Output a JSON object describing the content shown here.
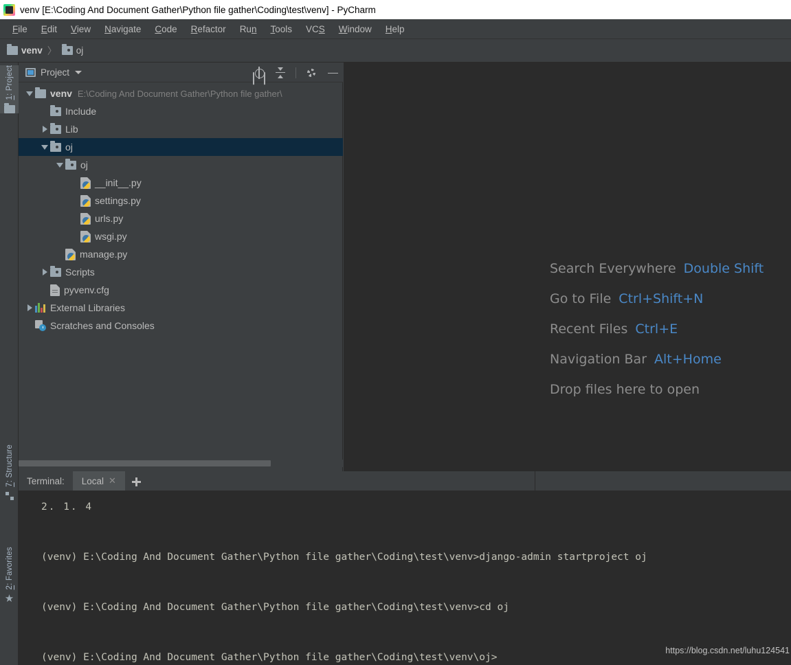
{
  "window": {
    "title": "venv [E:\\Coding And Document Gather\\Python file gather\\Coding\\test\\venv] - PyCharm",
    "logo_icon": "pycharm-logo-icon",
    "logo_text": "PC"
  },
  "menubar": {
    "items": [
      {
        "label": "File",
        "mnemonic": "F"
      },
      {
        "label": "Edit",
        "mnemonic": "E"
      },
      {
        "label": "View",
        "mnemonic": "V"
      },
      {
        "label": "Navigate",
        "mnemonic": "N"
      },
      {
        "label": "Code",
        "mnemonic": "C"
      },
      {
        "label": "Refactor",
        "mnemonic": "R"
      },
      {
        "label": "Run",
        "mnemonic": "n"
      },
      {
        "label": "Tools",
        "mnemonic": "T"
      },
      {
        "label": "VCS",
        "mnemonic": "S"
      },
      {
        "label": "Window",
        "mnemonic": "W"
      },
      {
        "label": "Help",
        "mnemonic": "H"
      }
    ]
  },
  "breadcrumb": {
    "separator": "〉",
    "items": [
      {
        "label": "venv",
        "icon": "folder-icon"
      },
      {
        "label": "oj",
        "icon": "folder-open-icon"
      }
    ]
  },
  "left_strip": {
    "top_tabs": [
      {
        "label": "1: Project",
        "icon": "project-folder-icon",
        "active": true
      }
    ],
    "bottom_tabs": [
      {
        "label": "7: Structure",
        "icon": "structure-icon",
        "active": false
      },
      {
        "label": "2: Favorites",
        "icon": "star-icon",
        "active": false
      }
    ]
  },
  "project_panel": {
    "title": "Project",
    "window_icon": "project-window-icon",
    "dropdown_icon": "chevron-down-icon",
    "toolbar": [
      {
        "name": "locate-icon",
        "tooltip": "Select Opened File"
      },
      {
        "name": "collapse-all-icon",
        "tooltip": "Collapse All"
      },
      {
        "name": "gear-icon",
        "tooltip": "Settings"
      },
      {
        "name": "hide-icon",
        "tooltip": "Hide"
      }
    ],
    "tree": [
      {
        "label": "venv",
        "path": "E:\\Coding And Document Gather\\Python file gather\\",
        "icon": "folder-icon",
        "arrow": "down",
        "indent": 0,
        "bold": true,
        "selected": false
      },
      {
        "label": "Include",
        "path": "",
        "icon": "folder-open-icon",
        "arrow": "none",
        "indent": 1,
        "bold": false,
        "selected": false
      },
      {
        "label": "Lib",
        "path": "",
        "icon": "folder-open-icon",
        "arrow": "right",
        "indent": 1,
        "bold": false,
        "selected": false
      },
      {
        "label": "oj",
        "path": "",
        "icon": "folder-open-icon",
        "arrow": "down",
        "indent": 1,
        "bold": false,
        "selected": true
      },
      {
        "label": "oj",
        "path": "",
        "icon": "folder-open-icon",
        "arrow": "down",
        "indent": 2,
        "bold": false,
        "selected": false
      },
      {
        "label": "__init__.py",
        "path": "",
        "icon": "python-file-icon",
        "arrow": "none",
        "indent": 3,
        "bold": false,
        "selected": false
      },
      {
        "label": "settings.py",
        "path": "",
        "icon": "python-file-icon",
        "arrow": "none",
        "indent": 3,
        "bold": false,
        "selected": false
      },
      {
        "label": "urls.py",
        "path": "",
        "icon": "python-file-icon",
        "arrow": "none",
        "indent": 3,
        "bold": false,
        "selected": false
      },
      {
        "label": "wsgi.py",
        "path": "",
        "icon": "python-file-icon",
        "arrow": "none",
        "indent": 3,
        "bold": false,
        "selected": false
      },
      {
        "label": "manage.py",
        "path": "",
        "icon": "python-file-icon",
        "arrow": "none",
        "indent": 2,
        "bold": false,
        "selected": false
      },
      {
        "label": "Scripts",
        "path": "",
        "icon": "folder-open-icon",
        "arrow": "right",
        "indent": 1,
        "bold": false,
        "selected": false
      },
      {
        "label": "pyvenv.cfg",
        "path": "",
        "icon": "file-icon",
        "arrow": "none",
        "indent": 1,
        "bold": false,
        "selected": false
      },
      {
        "label": "External Libraries",
        "path": "",
        "icon": "external-libraries-icon",
        "arrow": "right",
        "indent": 0,
        "bold": false,
        "selected": false
      },
      {
        "label": "Scratches and Consoles",
        "path": "",
        "icon": "scratches-icon",
        "arrow": "none",
        "indent": 0,
        "bold": false,
        "selected": false
      }
    ]
  },
  "editor": {
    "shortcuts": [
      {
        "name": "Search Everywhere",
        "key": "Double Shift"
      },
      {
        "name": "Go to File",
        "key": "Ctrl+Shift+N"
      },
      {
        "name": "Recent Files",
        "key": "Ctrl+E"
      },
      {
        "name": "Navigation Bar",
        "key": "Alt+Home"
      },
      {
        "name": "Drop files here to open",
        "key": ""
      }
    ],
    "key_color": "#4a88c7",
    "name_color": "#8d8d8d"
  },
  "terminal": {
    "label": "Terminal:",
    "tabs": [
      {
        "label": "Local",
        "close_icon": "close-icon",
        "active": true
      }
    ],
    "add_icon": "plus-icon",
    "lines": [
      "2. 1. 4",
      "(venv) E:\\Coding And Document Gather\\Python file gather\\Coding\\test\\venv>django-admin startproject oj",
      "(venv) E:\\Coding And Document Gather\\Python file gather\\Coding\\test\\venv>cd oj",
      "(venv) E:\\Coding And Document Gather\\Python file gather\\Coding\\test\\venv\\oj>"
    ]
  },
  "watermark": "https://blog.csdn.net/luhu124541"
}
